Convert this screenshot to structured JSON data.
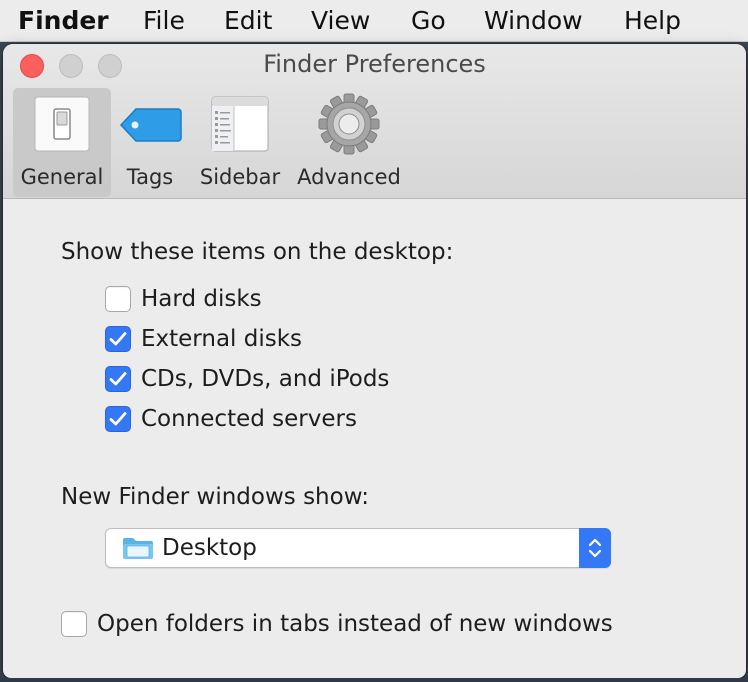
{
  "menubar": {
    "app": "Finder",
    "items": [
      "File",
      "Edit",
      "View",
      "Go",
      "Window",
      "Help"
    ]
  },
  "window": {
    "title": "Finder Preferences"
  },
  "toolbar": {
    "tabs": [
      {
        "label": "General",
        "icon": "general-switch-icon",
        "selected": true
      },
      {
        "label": "Tags",
        "icon": "tag-icon",
        "selected": false
      },
      {
        "label": "Sidebar",
        "icon": "sidebar-icon",
        "selected": false
      },
      {
        "label": "Advanced",
        "icon": "gear-icon",
        "selected": false
      }
    ]
  },
  "general": {
    "desktop_heading": "Show these items on the desktop:",
    "desktop_items": [
      {
        "label": "Hard disks",
        "checked": false
      },
      {
        "label": "External disks",
        "checked": true
      },
      {
        "label": "CDs, DVDs, and iPods",
        "checked": true
      },
      {
        "label": "Connected servers",
        "checked": true
      }
    ],
    "new_window_heading": "New Finder windows show:",
    "new_window_value": "Desktop",
    "open_in_tabs": {
      "label": "Open folders in tabs instead of new windows",
      "checked": false
    }
  },
  "colors": {
    "accent": "#3478f6",
    "close_button": "#fc605c",
    "window_bg": "#ececec"
  }
}
